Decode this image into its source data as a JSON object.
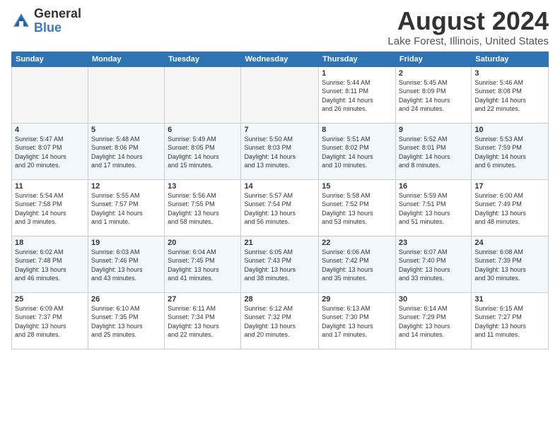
{
  "logo": {
    "general": "General",
    "blue": "Blue"
  },
  "header": {
    "title": "August 2024",
    "location": "Lake Forest, Illinois, United States"
  },
  "weekdays": [
    "Sunday",
    "Monday",
    "Tuesday",
    "Wednesday",
    "Thursday",
    "Friday",
    "Saturday"
  ],
  "weeks": [
    [
      {
        "day": "",
        "info": ""
      },
      {
        "day": "",
        "info": ""
      },
      {
        "day": "",
        "info": ""
      },
      {
        "day": "",
        "info": ""
      },
      {
        "day": "1",
        "info": "Sunrise: 5:44 AM\nSunset: 8:11 PM\nDaylight: 14 hours\nand 26 minutes."
      },
      {
        "day": "2",
        "info": "Sunrise: 5:45 AM\nSunset: 8:09 PM\nDaylight: 14 hours\nand 24 minutes."
      },
      {
        "day": "3",
        "info": "Sunrise: 5:46 AM\nSunset: 8:08 PM\nDaylight: 14 hours\nand 22 minutes."
      }
    ],
    [
      {
        "day": "4",
        "info": "Sunrise: 5:47 AM\nSunset: 8:07 PM\nDaylight: 14 hours\nand 20 minutes."
      },
      {
        "day": "5",
        "info": "Sunrise: 5:48 AM\nSunset: 8:06 PM\nDaylight: 14 hours\nand 17 minutes."
      },
      {
        "day": "6",
        "info": "Sunrise: 5:49 AM\nSunset: 8:05 PM\nDaylight: 14 hours\nand 15 minutes."
      },
      {
        "day": "7",
        "info": "Sunrise: 5:50 AM\nSunset: 8:03 PM\nDaylight: 14 hours\nand 13 minutes."
      },
      {
        "day": "8",
        "info": "Sunrise: 5:51 AM\nSunset: 8:02 PM\nDaylight: 14 hours\nand 10 minutes."
      },
      {
        "day": "9",
        "info": "Sunrise: 5:52 AM\nSunset: 8:01 PM\nDaylight: 14 hours\nand 8 minutes."
      },
      {
        "day": "10",
        "info": "Sunrise: 5:53 AM\nSunset: 7:59 PM\nDaylight: 14 hours\nand 6 minutes."
      }
    ],
    [
      {
        "day": "11",
        "info": "Sunrise: 5:54 AM\nSunset: 7:58 PM\nDaylight: 14 hours\nand 3 minutes."
      },
      {
        "day": "12",
        "info": "Sunrise: 5:55 AM\nSunset: 7:57 PM\nDaylight: 14 hours\nand 1 minute."
      },
      {
        "day": "13",
        "info": "Sunrise: 5:56 AM\nSunset: 7:55 PM\nDaylight: 13 hours\nand 58 minutes."
      },
      {
        "day": "14",
        "info": "Sunrise: 5:57 AM\nSunset: 7:54 PM\nDaylight: 13 hours\nand 56 minutes."
      },
      {
        "day": "15",
        "info": "Sunrise: 5:58 AM\nSunset: 7:52 PM\nDaylight: 13 hours\nand 53 minutes."
      },
      {
        "day": "16",
        "info": "Sunrise: 5:59 AM\nSunset: 7:51 PM\nDaylight: 13 hours\nand 51 minutes."
      },
      {
        "day": "17",
        "info": "Sunrise: 6:00 AM\nSunset: 7:49 PM\nDaylight: 13 hours\nand 48 minutes."
      }
    ],
    [
      {
        "day": "18",
        "info": "Sunrise: 6:02 AM\nSunset: 7:48 PM\nDaylight: 13 hours\nand 46 minutes."
      },
      {
        "day": "19",
        "info": "Sunrise: 6:03 AM\nSunset: 7:46 PM\nDaylight: 13 hours\nand 43 minutes."
      },
      {
        "day": "20",
        "info": "Sunrise: 6:04 AM\nSunset: 7:45 PM\nDaylight: 13 hours\nand 41 minutes."
      },
      {
        "day": "21",
        "info": "Sunrise: 6:05 AM\nSunset: 7:43 PM\nDaylight: 13 hours\nand 38 minutes."
      },
      {
        "day": "22",
        "info": "Sunrise: 6:06 AM\nSunset: 7:42 PM\nDaylight: 13 hours\nand 35 minutes."
      },
      {
        "day": "23",
        "info": "Sunrise: 6:07 AM\nSunset: 7:40 PM\nDaylight: 13 hours\nand 33 minutes."
      },
      {
        "day": "24",
        "info": "Sunrise: 6:08 AM\nSunset: 7:39 PM\nDaylight: 13 hours\nand 30 minutes."
      }
    ],
    [
      {
        "day": "25",
        "info": "Sunrise: 6:09 AM\nSunset: 7:37 PM\nDaylight: 13 hours\nand 28 minutes."
      },
      {
        "day": "26",
        "info": "Sunrise: 6:10 AM\nSunset: 7:35 PM\nDaylight: 13 hours\nand 25 minutes."
      },
      {
        "day": "27",
        "info": "Sunrise: 6:11 AM\nSunset: 7:34 PM\nDaylight: 13 hours\nand 22 minutes."
      },
      {
        "day": "28",
        "info": "Sunrise: 6:12 AM\nSunset: 7:32 PM\nDaylight: 13 hours\nand 20 minutes."
      },
      {
        "day": "29",
        "info": "Sunrise: 6:13 AM\nSunset: 7:30 PM\nDaylight: 13 hours\nand 17 minutes."
      },
      {
        "day": "30",
        "info": "Sunrise: 6:14 AM\nSunset: 7:29 PM\nDaylight: 13 hours\nand 14 minutes."
      },
      {
        "day": "31",
        "info": "Sunrise: 6:15 AM\nSunset: 7:27 PM\nDaylight: 13 hours\nand 11 minutes."
      }
    ]
  ]
}
